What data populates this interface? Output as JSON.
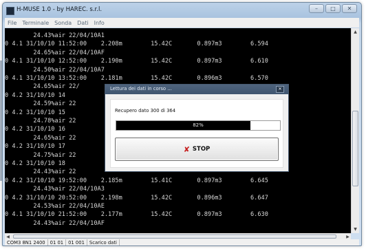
{
  "window": {
    "title": "H-MUSE 1.0 - by HAREC. s.r.l.",
    "controls": {
      "minimize": "–",
      "maximize": "□",
      "close": "✕"
    }
  },
  "menu": {
    "items": [
      "File",
      "Terminale",
      "Sonda",
      "Dati",
      "Info"
    ]
  },
  "terminal": {
    "lines": [
      "        24.43%air 22/04/10A1",
      "0 4.1 31/10/10 11:52:00    2.208m        15.42C       0.897m3        6.594",
      "        24.65%air 22/04/10AF",
      "0 4.1 31/10/10 12:52:00    2.190m        15.42C       0.897m3        6.610",
      "        24.50%air 22/04/10A7",
      "0 4.1 31/10/10 13:52:00    2.181m        15.42C       0.896m3        6.570",
      "        24.65%air 22/",
      "0 4.2 31/10/10 14                                      7m3           6.581",
      "        24.59%air 22",
      "0 4.2 31/10/10 15                                      7m3           6.602",
      "        24.78%air 22",
      "0 4.2 31/10/10 16                                      7m3           6.638",
      "        24.65%air 22",
      "0 4.2 31/10/10 17                                      7m3           6.638",
      "        24.75%air 22",
      "0 4.2 31/10/10 18                                      7m3           6.638",
      "        24.43%air 22",
      "0 4.2 31/10/10 19:52:00    2.185m        15.41C       0.897m3        6.645",
      "        24.43%air 22/04/10A3",
      "0 4.2 31/10/10 20:52:00    2.198m        15.42C       0.896m3        6.647",
      "        24.53%air 22/04/10AE",
      "0 4.1 31/10/10 21:52:00    2.177m        15.42C       0.897m3        6.630",
      "        24.43%air 22/04/10AF"
    ]
  },
  "statusbar": {
    "cells": [
      "COM3 8N1 2400",
      "01 01",
      "01 001",
      "Scarico dati"
    ]
  },
  "dialog": {
    "title": "Lettura dei dati in corso ...",
    "close": "✕",
    "message": "Recupero dato 300 di 364",
    "progress_text": "82%",
    "progress_fraction": 0.82,
    "stop_icon": "✘",
    "stop_label": "STOP"
  },
  "icons": {
    "app": "app-icon",
    "stop": "x-icon",
    "scroll_up": "▲",
    "scroll_down": "▼",
    "scroll_left": "◀",
    "scroll_right": "▶"
  },
  "colors": {
    "terminal_bg": "#000000",
    "terminal_text": "#d8d8d8",
    "stop_icon": "#c61f1f"
  }
}
